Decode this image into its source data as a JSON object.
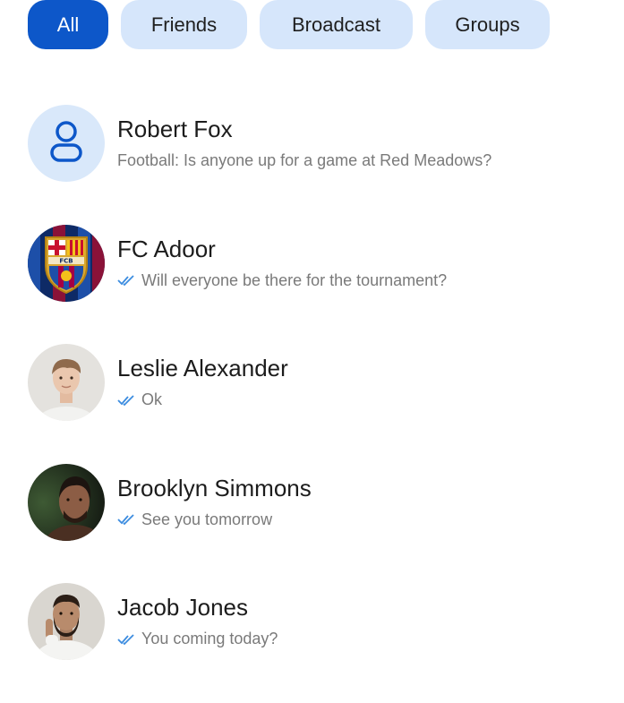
{
  "filters": {
    "all": "All",
    "friends": "Friends",
    "broadcast": "Broadcast",
    "groups": "Groups",
    "active": "All"
  },
  "chats": [
    {
      "name": "Robert Fox",
      "message": "Football: Is anyone up for a game at Red Meadows?",
      "read": false,
      "avatar": "person-icon"
    },
    {
      "name": "FC Adoor",
      "message": "Will everyone be there for the tournament?",
      "read": true,
      "avatar": "club-crest"
    },
    {
      "name": "Leslie Alexander",
      "message": "Ok",
      "read": true,
      "avatar": "photo"
    },
    {
      "name": "Brooklyn Simmons",
      "message": "See you tomorrow",
      "read": true,
      "avatar": "photo"
    },
    {
      "name": "Jacob Jones",
      "message": "You coming today?",
      "read": true,
      "avatar": "photo"
    }
  ],
  "colors": {
    "accent": "#0d57c9",
    "chip_bg": "#d6e6fb",
    "check": "#3d8de0"
  }
}
